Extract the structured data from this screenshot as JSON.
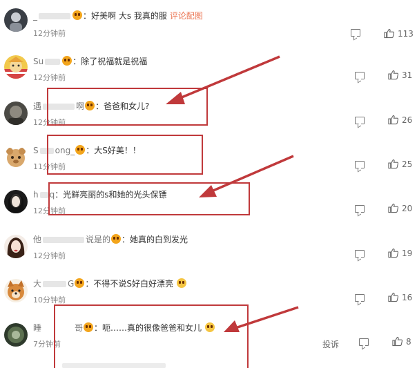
{
  "comments": [
    {
      "name": "_",
      "text": "：好美啊 大s 我真的服",
      "extra_link": "评论配图",
      "time": "12分钟前",
      "likes": "113"
    },
    {
      "name": "Su",
      "text": "：除了祝福就是祝福",
      "time": "12分钟前",
      "likes": "31"
    },
    {
      "name": "遇",
      "name_end": "啊",
      "text": "：爸爸和女儿?",
      "time": "12分钟前",
      "likes": "26"
    },
    {
      "name": "S",
      "name_end": "ong_",
      "text": "：大S好美！！",
      "time": "11分钟前",
      "likes": "25"
    },
    {
      "name": "h",
      "name_end": "q",
      "text": "：光鲜亮丽的s和她的光头保镖",
      "time": "12分钟前",
      "likes": "20"
    },
    {
      "name": "他",
      "name_end": "说是的",
      "text": "：她真的白到发光",
      "time": "12分钟前",
      "likes": "19"
    },
    {
      "name": "大",
      "name_end": "G",
      "text": "：不得不说S好白好漂亮",
      "time": "10分钟前",
      "likes": "16"
    },
    {
      "name": "睡",
      "name_end": "哥",
      "text": "：呃……真的很像爸爸和女儿",
      "time": "7分钟前",
      "likes": "8",
      "report": "投诉"
    }
  ],
  "colors": {
    "annotation": "#c0393b",
    "link": "#eb7350"
  }
}
